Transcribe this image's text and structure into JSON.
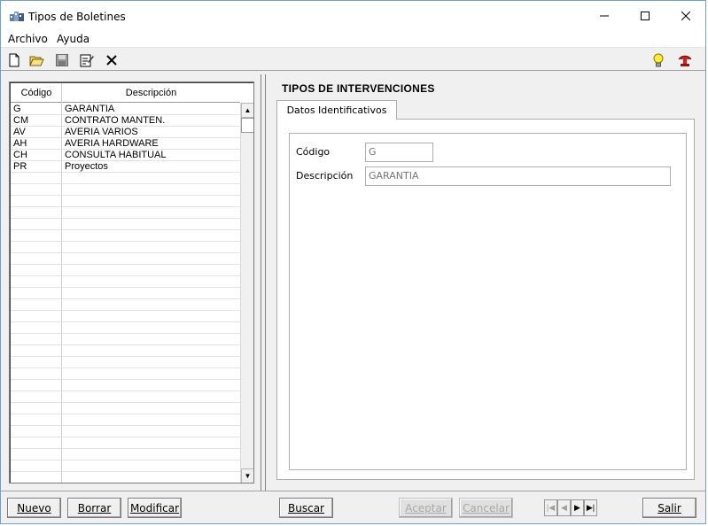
{
  "window": {
    "title": "Tipos de Boletines"
  },
  "menu": {
    "items": [
      "Archivo",
      "Ayuda"
    ]
  },
  "toolbar": {
    "icons": [
      "new-icon",
      "open-icon",
      "save-icon",
      "edit-icon",
      "delete-icon",
      "lightbulb-icon",
      "help-icon"
    ]
  },
  "list": {
    "headers": {
      "code": "Código",
      "description": "Descripción"
    },
    "rows": [
      {
        "code": "G",
        "description": "GARANTIA"
      },
      {
        "code": "CM",
        "description": "CONTRATO MANTEN."
      },
      {
        "code": "AV",
        "description": "AVERIA VARIOS"
      },
      {
        "code": "AH",
        "description": "AVERIA HARDWARE"
      },
      {
        "code": "CH",
        "description": "CONSULTA HABITUAL"
      },
      {
        "code": "PR",
        "description": "Proyectos"
      }
    ]
  },
  "detail": {
    "section_title": "TIPOS DE INTERVENCIONES",
    "tab_label": "Datos Identificativos",
    "code_label": "Código",
    "code_value": "G",
    "description_label": "Descripción",
    "description_value": "GARANTIA"
  },
  "buttons": {
    "nuevo": "Nuevo",
    "borrar": "Borrar",
    "modificar": "Modificar",
    "buscar": "Buscar",
    "aceptar": "Aceptar",
    "cancelar": "Cancelar",
    "salir": "Salir"
  },
  "colors": {
    "window_border": "#6d9ed4",
    "face": "#f0f0f0",
    "disabled_text": "#a8a8a8"
  }
}
